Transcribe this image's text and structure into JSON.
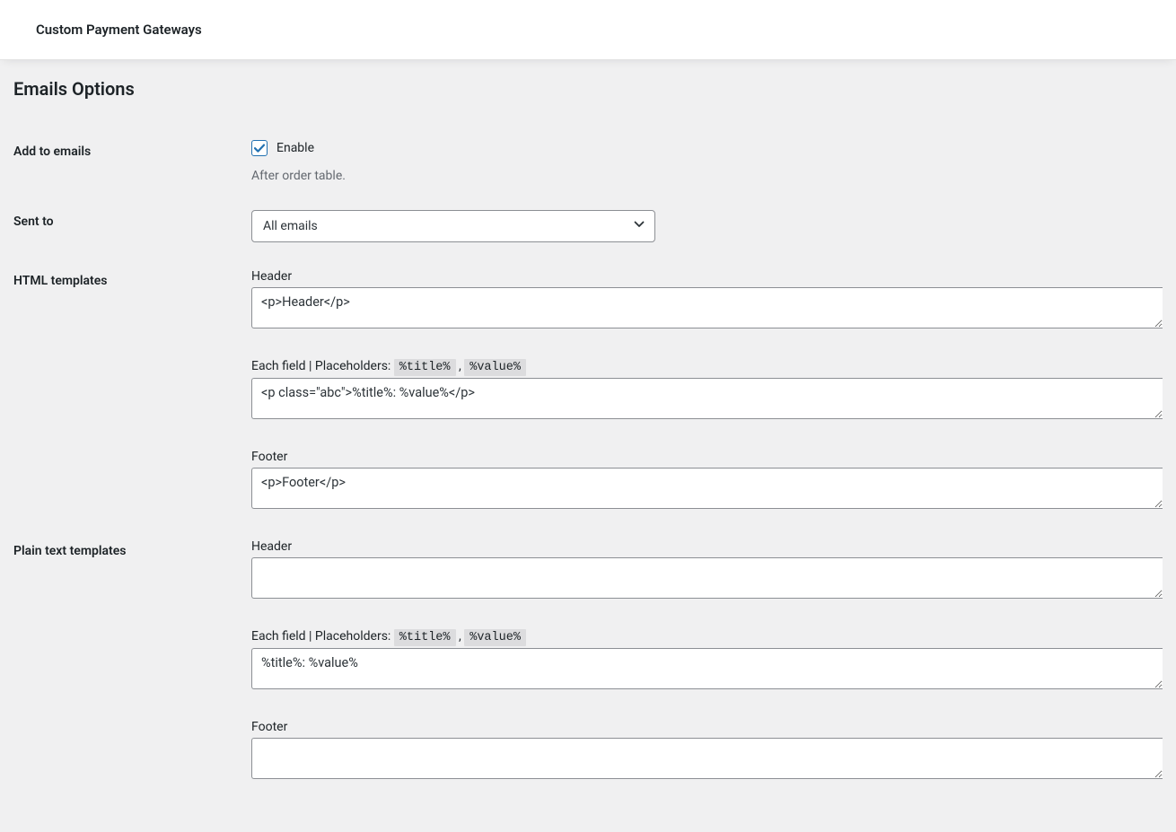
{
  "topbar": {
    "title": "Custom Payment Gateways"
  },
  "section_title": "Emails Options",
  "rows": {
    "add_to_emails": {
      "label": "Add to emails",
      "checkbox_label": "Enable",
      "checked": true,
      "description": "After order table."
    },
    "sent_to": {
      "label": "Sent to",
      "value": "All emails"
    },
    "html_templates": {
      "label": "HTML templates",
      "header_label": "Header",
      "header_value": "<p>Header</p>",
      "each_field_prefix": "Each field | Placeholders: ",
      "placeholder_title": "%title%",
      "placeholder_sep": " , ",
      "placeholder_value": "%value%",
      "each_field_value": "<p class=\"abc\">%title%: %value%</p>",
      "footer_label": "Footer",
      "footer_value": "<p>Footer</p>"
    },
    "plain_templates": {
      "label": "Plain text templates",
      "header_label": "Header",
      "header_value": "",
      "each_field_prefix": "Each field | Placeholders: ",
      "placeholder_title": "%title%",
      "placeholder_sep": " , ",
      "placeholder_value": "%value%",
      "each_field_value": "%title%: %value%",
      "footer_label": "Footer",
      "footer_value": ""
    }
  }
}
